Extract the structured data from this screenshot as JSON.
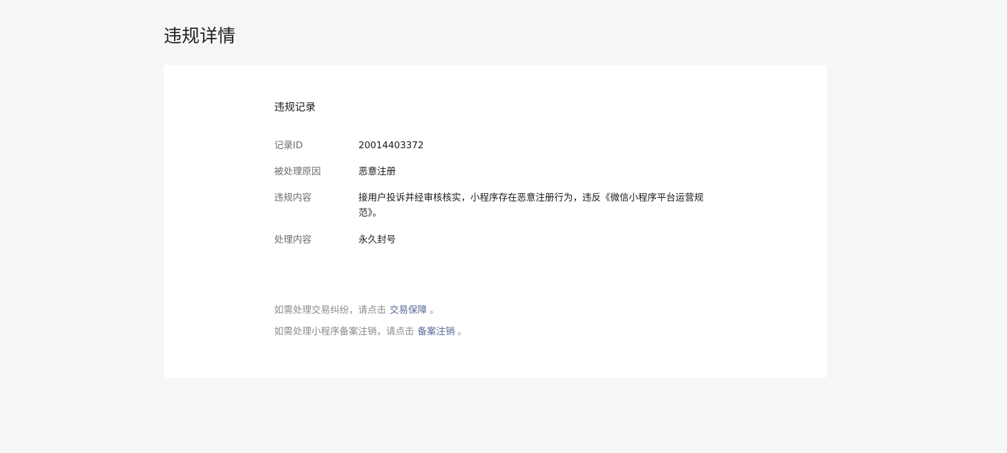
{
  "page": {
    "title": "违规详情"
  },
  "record": {
    "section_title": "违规记录",
    "fields": [
      {
        "label": "记录ID",
        "value": "20014403372"
      },
      {
        "label": "被处理原因",
        "value": "恶意注册"
      },
      {
        "label": "违规内容",
        "value": "接用户投诉并经审核核实，小程序存在恶意注册行为，违反《微信小程序平台运营规范》。"
      },
      {
        "label": "处理内容",
        "value": "永久封号"
      }
    ]
  },
  "hints": [
    {
      "prefix": "如需处理交易纠纷，请点击",
      "link": "交易保障",
      "suffix": "。"
    },
    {
      "prefix": "如需处理小程序备案注销，请点击",
      "link": "备案注销",
      "suffix": "。"
    }
  ],
  "colors": {
    "background": "#f5f6f7",
    "card": "#ffffff",
    "link": "#576b95",
    "label": "#6b6b6b",
    "hint": "#8a8a8a"
  }
}
